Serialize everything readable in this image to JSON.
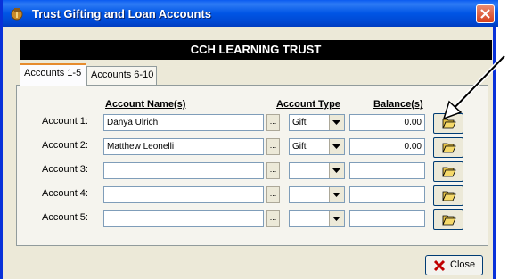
{
  "window": {
    "title": "Trust Gifting and Loan Accounts"
  },
  "banner": "CCH LEARNING TRUST",
  "tabs": [
    {
      "label": "Accounts 1-5",
      "active": true
    },
    {
      "label": "Accounts 6-10",
      "active": false
    }
  ],
  "headers": {
    "name": "Account Name(s)",
    "type": "Account Type",
    "balance": "Balance(s)"
  },
  "ellipsis_label": "...",
  "accounts": [
    {
      "label": "Account 1:",
      "name": "Danya Ulrich",
      "type": "Gift",
      "balance": "0.00"
    },
    {
      "label": "Account 2:",
      "name": "Matthew Leonelli",
      "type": "Gift",
      "balance": "0.00"
    },
    {
      "label": "Account 3:",
      "name": "",
      "type": "",
      "balance": ""
    },
    {
      "label": "Account 4:",
      "name": "",
      "type": "",
      "balance": ""
    },
    {
      "label": "Account 5:",
      "name": "",
      "type": "",
      "balance": ""
    }
  ],
  "close_button": {
    "label": "Close"
  },
  "icons": {
    "app": "trust-app-icon",
    "folder": "open-folder-icon",
    "close": "close-icon",
    "arrow": "pointer-arrow-icon"
  }
}
